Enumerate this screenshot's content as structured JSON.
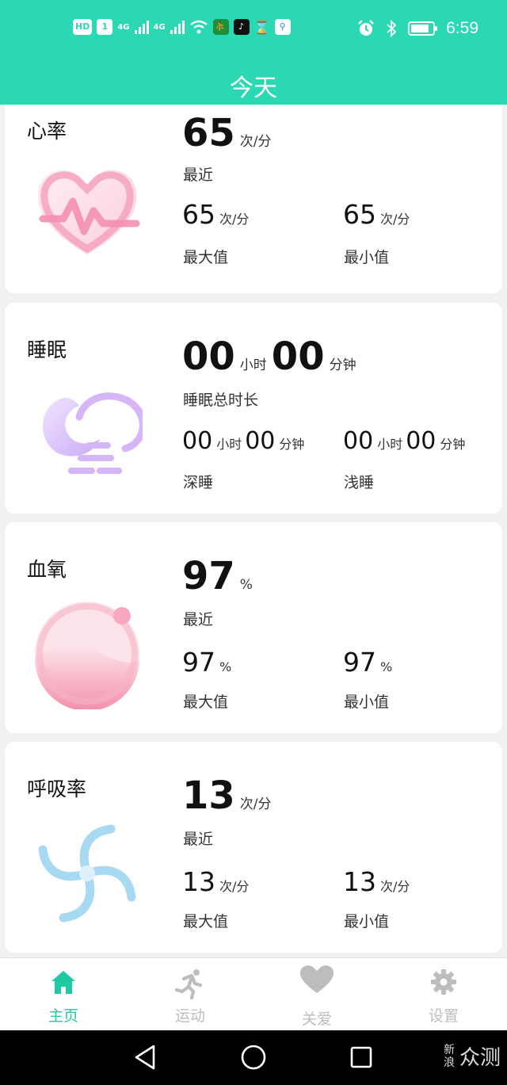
{
  "status_bar": {
    "hd": "HD",
    "sim": "1",
    "net1": "4G",
    "net2": "4G",
    "time": "6:59"
  },
  "header": {
    "title": "今天"
  },
  "cards": {
    "heart": {
      "title": "心率",
      "value": "65",
      "unit": "次/分",
      "label": "最近",
      "max": {
        "value": "65",
        "unit": "次/分",
        "label": "最大值"
      },
      "min": {
        "value": "65",
        "unit": "次/分",
        "label": "最小值"
      }
    },
    "sleep": {
      "title": "睡眠",
      "hours": "00",
      "hours_unit": "小时",
      "minutes": "00",
      "minutes_unit": "分钟",
      "label": "睡眠总时长",
      "deep": {
        "hours": "00",
        "hours_unit": "小时",
        "minutes": "00",
        "minutes_unit": "分钟",
        "label": "深睡"
      },
      "light": {
        "hours": "00",
        "hours_unit": "小时",
        "minutes": "00",
        "minutes_unit": "分钟",
        "label": "浅睡"
      }
    },
    "oxygen": {
      "title": "血氧",
      "value": "97",
      "unit": "%",
      "label": "最近",
      "max": {
        "value": "97",
        "unit": "%",
        "label": "最大值"
      },
      "min": {
        "value": "97",
        "unit": "%",
        "label": "最小值"
      }
    },
    "respiration": {
      "title": "呼吸率",
      "value": "13",
      "unit": "次/分",
      "label": "最近",
      "max": {
        "value": "13",
        "unit": "次/分",
        "label": "最大值"
      },
      "min": {
        "value": "13",
        "unit": "次/分",
        "label": "最小值"
      }
    }
  },
  "bottom_nav": [
    {
      "label": "主页",
      "icon": "home-icon",
      "active": true
    },
    {
      "label": "运动",
      "icon": "running-icon",
      "active": false
    },
    {
      "label": "关爱",
      "icon": "heart-icon",
      "active": false
    },
    {
      "label": "设置",
      "icon": "gear-icon",
      "active": false
    }
  ],
  "watermark": {
    "small_top": "新",
    "small_bottom": "浪",
    "text": "众测"
  },
  "colors": {
    "accent": "#2ad8b4",
    "nav_active": "#1fc9a4",
    "nav_inactive": "#bdbdbd"
  }
}
